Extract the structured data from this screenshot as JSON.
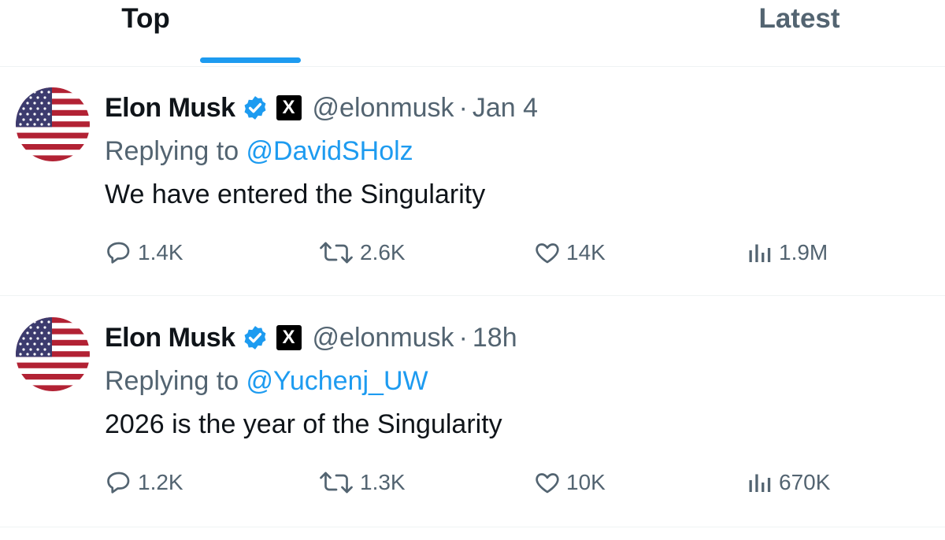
{
  "tabs": [
    {
      "label": "Top",
      "active": true
    },
    {
      "label": "Latest",
      "active": false
    }
  ],
  "colors": {
    "accent": "#1d9bf0",
    "text_primary": "#0f1419",
    "text_secondary": "#536471",
    "divider": "#eff3f4"
  },
  "tweets": [
    {
      "author_name": "Elon Musk",
      "handle": "@elonmusk",
      "separator": "·",
      "time": "Jan 4",
      "replying_prefix": "Replying to ",
      "replying_to": "@DavidSHolz",
      "text": "We have entered the Singularity",
      "replies": "1.4K",
      "reposts": "2.6K",
      "likes": "14K",
      "views": "1.9M",
      "avatar_icon": "us-flag-avatar",
      "badges": [
        "verified-badge-icon",
        "x-affiliate-badge-icon"
      ]
    },
    {
      "author_name": "Elon Musk",
      "handle": "@elonmusk",
      "separator": "·",
      "time": "18h",
      "replying_prefix": "Replying to ",
      "replying_to": "@Yuchenj_UW",
      "text": "2026 is the year of the Singularity",
      "replies": "1.2K",
      "reposts": "1.3K",
      "likes": "10K",
      "views": "670K",
      "avatar_icon": "us-flag-avatar",
      "badges": [
        "verified-badge-icon",
        "x-affiliate-badge-icon"
      ]
    }
  ],
  "badge_letter": "X"
}
